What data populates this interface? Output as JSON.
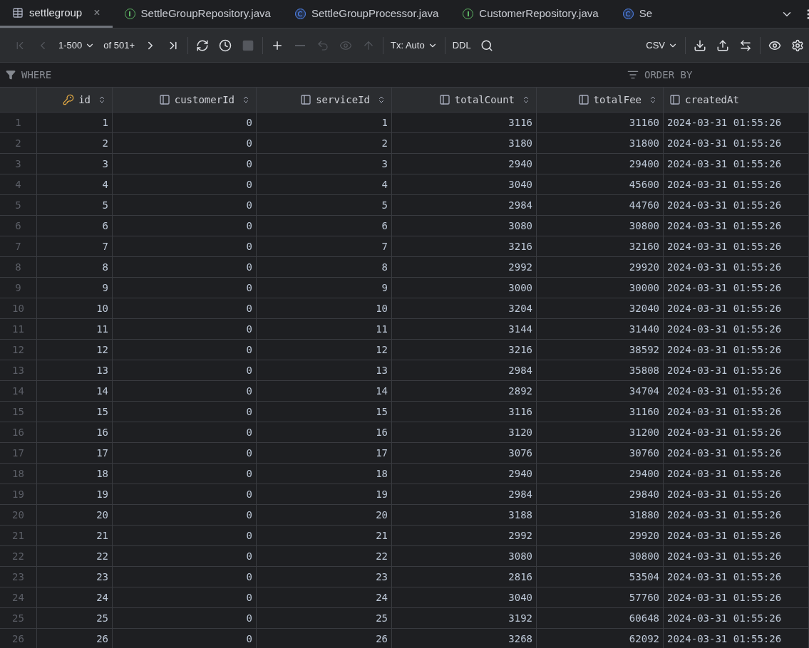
{
  "tabs": [
    {
      "label": "settlegroup",
      "kind": "table",
      "selected": true,
      "close": "×"
    },
    {
      "label": "SettleGroupRepository.java",
      "kind": "interface",
      "selected": false
    },
    {
      "label": "SettleGroupProcessor.java",
      "kind": "class",
      "selected": false
    },
    {
      "label": "CustomerRepository.java",
      "kind": "interface",
      "selected": false
    },
    {
      "label": "Se",
      "kind": "class",
      "selected": false
    }
  ],
  "toolbar": [
    {
      "kind": "first",
      "disabled": true
    },
    {
      "kind": "prev",
      "disabled": true
    },
    {
      "kind": "dropdown",
      "label": "1-500"
    },
    {
      "kind": "text",
      "label": "of 501+"
    },
    {
      "kind": "next",
      "disabled": false
    },
    {
      "kind": "last",
      "disabled": false
    },
    {
      "kind": "separator"
    },
    {
      "kind": "refresh",
      "disabled": false
    },
    {
      "kind": "history",
      "disabled": false
    },
    {
      "kind": "stop",
      "disabled": true
    },
    {
      "kind": "separator"
    },
    {
      "kind": "add",
      "disabled": false
    },
    {
      "kind": "remove",
      "disabled": true
    },
    {
      "kind": "revert",
      "disabled": true
    },
    {
      "kind": "preview",
      "disabled": true
    },
    {
      "kind": "submit",
      "disabled": true
    },
    {
      "kind": "separator"
    },
    {
      "kind": "dropdown",
      "label": "Tx: Auto"
    },
    {
      "kind": "separator"
    },
    {
      "kind": "text",
      "label": "DDL"
    },
    {
      "kind": "search",
      "disabled": false
    },
    {
      "kind": "spacer"
    },
    {
      "kind": "dropdown",
      "label": "CSV"
    },
    {
      "kind": "separator"
    },
    {
      "kind": "download",
      "disabled": false
    },
    {
      "kind": "upload",
      "disabled": false
    },
    {
      "kind": "compare",
      "disabled": false
    },
    {
      "kind": "separator"
    },
    {
      "kind": "view",
      "disabled": false
    },
    {
      "kind": "settings",
      "disabled": false
    }
  ],
  "filter": {
    "where": "WHERE",
    "order_by": "ORDER BY"
  },
  "table": {
    "columns": [
      {
        "label": "id",
        "kind": "key",
        "sortable": true
      },
      {
        "label": "customerId",
        "kind": "column",
        "sortable": true
      },
      {
        "label": "serviceId",
        "kind": "column",
        "sortable": true
      },
      {
        "label": "totalCount",
        "kind": "column",
        "sortable": true
      },
      {
        "label": "totalFee",
        "kind": "column",
        "sortable": true
      },
      {
        "label": "createdAt",
        "kind": "column",
        "sortable": false
      }
    ],
    "rows": [
      {
        "number": "1",
        "cells": [
          "1",
          "0",
          "1",
          "3116",
          "31160",
          "2024-03-31 01:55:26"
        ]
      },
      {
        "number": "2",
        "cells": [
          "2",
          "0",
          "2",
          "3180",
          "31800",
          "2024-03-31 01:55:26"
        ]
      },
      {
        "number": "3",
        "cells": [
          "3",
          "0",
          "3",
          "2940",
          "29400",
          "2024-03-31 01:55:26"
        ]
      },
      {
        "number": "4",
        "cells": [
          "4",
          "0",
          "4",
          "3040",
          "45600",
          "2024-03-31 01:55:26"
        ]
      },
      {
        "number": "5",
        "cells": [
          "5",
          "0",
          "5",
          "2984",
          "44760",
          "2024-03-31 01:55:26"
        ]
      },
      {
        "number": "6",
        "cells": [
          "6",
          "0",
          "6",
          "3080",
          "30800",
          "2024-03-31 01:55:26"
        ]
      },
      {
        "number": "7",
        "cells": [
          "7",
          "0",
          "7",
          "3216",
          "32160",
          "2024-03-31 01:55:26"
        ]
      },
      {
        "number": "8",
        "cells": [
          "8",
          "0",
          "8",
          "2992",
          "29920",
          "2024-03-31 01:55:26"
        ]
      },
      {
        "number": "9",
        "cells": [
          "9",
          "0",
          "9",
          "3000",
          "30000",
          "2024-03-31 01:55:26"
        ]
      },
      {
        "number": "10",
        "cells": [
          "10",
          "0",
          "10",
          "3204",
          "32040",
          "2024-03-31 01:55:26"
        ]
      },
      {
        "number": "11",
        "cells": [
          "11",
          "0",
          "11",
          "3144",
          "31440",
          "2024-03-31 01:55:26"
        ]
      },
      {
        "number": "12",
        "cells": [
          "12",
          "0",
          "12",
          "3216",
          "38592",
          "2024-03-31 01:55:26"
        ]
      },
      {
        "number": "13",
        "cells": [
          "13",
          "0",
          "13",
          "2984",
          "35808",
          "2024-03-31 01:55:26"
        ]
      },
      {
        "number": "14",
        "cells": [
          "14",
          "0",
          "14",
          "2892",
          "34704",
          "2024-03-31 01:55:26"
        ]
      },
      {
        "number": "15",
        "cells": [
          "15",
          "0",
          "15",
          "3116",
          "31160",
          "2024-03-31 01:55:26"
        ]
      },
      {
        "number": "16",
        "cells": [
          "16",
          "0",
          "16",
          "3120",
          "31200",
          "2024-03-31 01:55:26"
        ]
      },
      {
        "number": "17",
        "cells": [
          "17",
          "0",
          "17",
          "3076",
          "30760",
          "2024-03-31 01:55:26"
        ]
      },
      {
        "number": "18",
        "cells": [
          "18",
          "0",
          "18",
          "2940",
          "29400",
          "2024-03-31 01:55:26"
        ]
      },
      {
        "number": "19",
        "cells": [
          "19",
          "0",
          "19",
          "2984",
          "29840",
          "2024-03-31 01:55:26"
        ]
      },
      {
        "number": "20",
        "cells": [
          "20",
          "0",
          "20",
          "3188",
          "31880",
          "2024-03-31 01:55:26"
        ]
      },
      {
        "number": "21",
        "cells": [
          "21",
          "0",
          "21",
          "2992",
          "29920",
          "2024-03-31 01:55:26"
        ]
      },
      {
        "number": "22",
        "cells": [
          "22",
          "0",
          "22",
          "3080",
          "30800",
          "2024-03-31 01:55:26"
        ]
      },
      {
        "number": "23",
        "cells": [
          "23",
          "0",
          "23",
          "2816",
          "53504",
          "2024-03-31 01:55:26"
        ]
      },
      {
        "number": "24",
        "cells": [
          "24",
          "0",
          "24",
          "3040",
          "57760",
          "2024-03-31 01:55:26"
        ]
      },
      {
        "number": "25",
        "cells": [
          "25",
          "0",
          "25",
          "3192",
          "60648",
          "2024-03-31 01:55:26"
        ]
      },
      {
        "number": "26",
        "cells": [
          "26",
          "0",
          "26",
          "3268",
          "62092",
          "2024-03-31 01:55:26"
        ]
      }
    ]
  }
}
